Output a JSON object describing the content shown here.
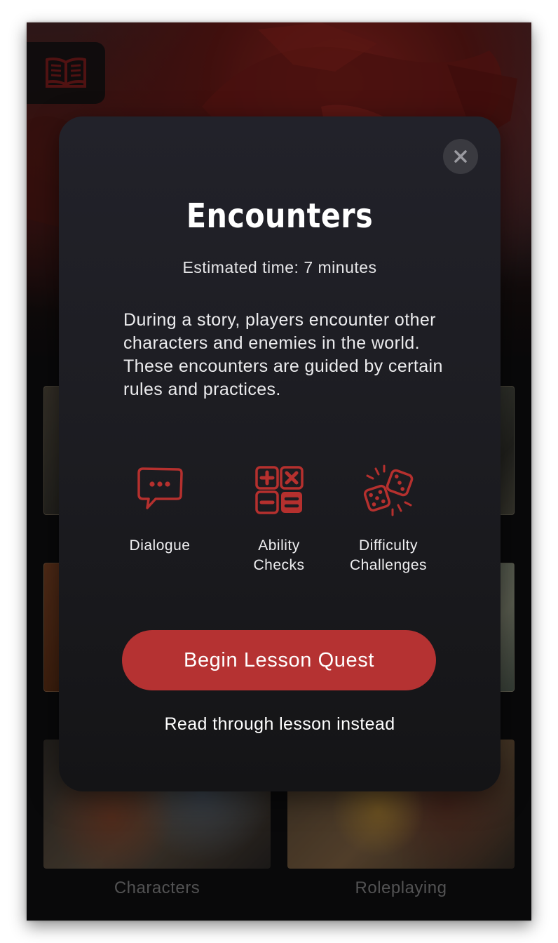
{
  "background": {
    "cards": [
      {
        "label": ""
      },
      {
        "label": ""
      },
      {
        "label": ""
      },
      {
        "label": ""
      },
      {
        "label": "Characters"
      },
      {
        "label": "Roleplaying"
      }
    ]
  },
  "modal": {
    "title": "Encounters",
    "estimated_time": "Estimated time: 7 minutes",
    "description": "During a story, players encounter other characters and enemies in the world. These encounters are guided by certain rules and practices.",
    "topics": [
      {
        "icon": "speech-bubble-icon",
        "label_line1": "Dialogue",
        "label_line2": ""
      },
      {
        "icon": "calculator-icon",
        "label_line1": "Ability",
        "label_line2": "Checks"
      },
      {
        "icon": "dice-icon",
        "label_line1": "Difficulty",
        "label_line2": "Challenges"
      }
    ],
    "primary_button": "Begin Lesson Quest",
    "secondary_link": "Read through lesson instead",
    "close_icon": "close-icon"
  },
  "colors": {
    "accent": "#b53232",
    "modal_bg": "#1c1c21",
    "icon_red": "#b5302e"
  }
}
